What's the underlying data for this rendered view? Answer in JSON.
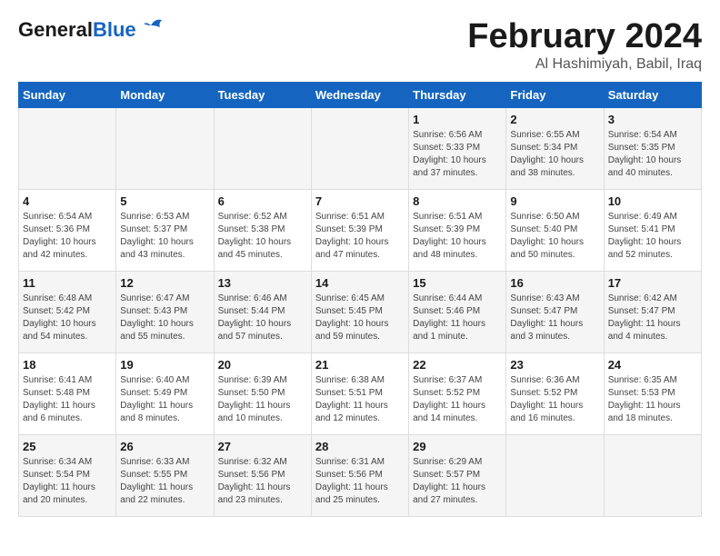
{
  "header": {
    "logo_general": "General",
    "logo_blue": "Blue",
    "title": "February 2024",
    "subtitle": "Al Hashimiyah, Babil, Iraq"
  },
  "weekdays": [
    "Sunday",
    "Monday",
    "Tuesday",
    "Wednesday",
    "Thursday",
    "Friday",
    "Saturday"
  ],
  "weeks": [
    [
      {
        "day": "",
        "sunrise": "",
        "sunset": "",
        "daylight": ""
      },
      {
        "day": "",
        "sunrise": "",
        "sunset": "",
        "daylight": ""
      },
      {
        "day": "",
        "sunrise": "",
        "sunset": "",
        "daylight": ""
      },
      {
        "day": "",
        "sunrise": "",
        "sunset": "",
        "daylight": ""
      },
      {
        "day": "1",
        "sunrise": "Sunrise: 6:56 AM",
        "sunset": "Sunset: 5:33 PM",
        "daylight": "Daylight: 10 hours and 37 minutes."
      },
      {
        "day": "2",
        "sunrise": "Sunrise: 6:55 AM",
        "sunset": "Sunset: 5:34 PM",
        "daylight": "Daylight: 10 hours and 38 minutes."
      },
      {
        "day": "3",
        "sunrise": "Sunrise: 6:54 AM",
        "sunset": "Sunset: 5:35 PM",
        "daylight": "Daylight: 10 hours and 40 minutes."
      }
    ],
    [
      {
        "day": "4",
        "sunrise": "Sunrise: 6:54 AM",
        "sunset": "Sunset: 5:36 PM",
        "daylight": "Daylight: 10 hours and 42 minutes."
      },
      {
        "day": "5",
        "sunrise": "Sunrise: 6:53 AM",
        "sunset": "Sunset: 5:37 PM",
        "daylight": "Daylight: 10 hours and 43 minutes."
      },
      {
        "day": "6",
        "sunrise": "Sunrise: 6:52 AM",
        "sunset": "Sunset: 5:38 PM",
        "daylight": "Daylight: 10 hours and 45 minutes."
      },
      {
        "day": "7",
        "sunrise": "Sunrise: 6:51 AM",
        "sunset": "Sunset: 5:39 PM",
        "daylight": "Daylight: 10 hours and 47 minutes."
      },
      {
        "day": "8",
        "sunrise": "Sunrise: 6:51 AM",
        "sunset": "Sunset: 5:39 PM",
        "daylight": "Daylight: 10 hours and 48 minutes."
      },
      {
        "day": "9",
        "sunrise": "Sunrise: 6:50 AM",
        "sunset": "Sunset: 5:40 PM",
        "daylight": "Daylight: 10 hours and 50 minutes."
      },
      {
        "day": "10",
        "sunrise": "Sunrise: 6:49 AM",
        "sunset": "Sunset: 5:41 PM",
        "daylight": "Daylight: 10 hours and 52 minutes."
      }
    ],
    [
      {
        "day": "11",
        "sunrise": "Sunrise: 6:48 AM",
        "sunset": "Sunset: 5:42 PM",
        "daylight": "Daylight: 10 hours and 54 minutes."
      },
      {
        "day": "12",
        "sunrise": "Sunrise: 6:47 AM",
        "sunset": "Sunset: 5:43 PM",
        "daylight": "Daylight: 10 hours and 55 minutes."
      },
      {
        "day": "13",
        "sunrise": "Sunrise: 6:46 AM",
        "sunset": "Sunset: 5:44 PM",
        "daylight": "Daylight: 10 hours and 57 minutes."
      },
      {
        "day": "14",
        "sunrise": "Sunrise: 6:45 AM",
        "sunset": "Sunset: 5:45 PM",
        "daylight": "Daylight: 10 hours and 59 minutes."
      },
      {
        "day": "15",
        "sunrise": "Sunrise: 6:44 AM",
        "sunset": "Sunset: 5:46 PM",
        "daylight": "Daylight: 11 hours and 1 minute."
      },
      {
        "day": "16",
        "sunrise": "Sunrise: 6:43 AM",
        "sunset": "Sunset: 5:47 PM",
        "daylight": "Daylight: 11 hours and 3 minutes."
      },
      {
        "day": "17",
        "sunrise": "Sunrise: 6:42 AM",
        "sunset": "Sunset: 5:47 PM",
        "daylight": "Daylight: 11 hours and 4 minutes."
      }
    ],
    [
      {
        "day": "18",
        "sunrise": "Sunrise: 6:41 AM",
        "sunset": "Sunset: 5:48 PM",
        "daylight": "Daylight: 11 hours and 6 minutes."
      },
      {
        "day": "19",
        "sunrise": "Sunrise: 6:40 AM",
        "sunset": "Sunset: 5:49 PM",
        "daylight": "Daylight: 11 hours and 8 minutes."
      },
      {
        "day": "20",
        "sunrise": "Sunrise: 6:39 AM",
        "sunset": "Sunset: 5:50 PM",
        "daylight": "Daylight: 11 hours and 10 minutes."
      },
      {
        "day": "21",
        "sunrise": "Sunrise: 6:38 AM",
        "sunset": "Sunset: 5:51 PM",
        "daylight": "Daylight: 11 hours and 12 minutes."
      },
      {
        "day": "22",
        "sunrise": "Sunrise: 6:37 AM",
        "sunset": "Sunset: 5:52 PM",
        "daylight": "Daylight: 11 hours and 14 minutes."
      },
      {
        "day": "23",
        "sunrise": "Sunrise: 6:36 AM",
        "sunset": "Sunset: 5:52 PM",
        "daylight": "Daylight: 11 hours and 16 minutes."
      },
      {
        "day": "24",
        "sunrise": "Sunrise: 6:35 AM",
        "sunset": "Sunset: 5:53 PM",
        "daylight": "Daylight: 11 hours and 18 minutes."
      }
    ],
    [
      {
        "day": "25",
        "sunrise": "Sunrise: 6:34 AM",
        "sunset": "Sunset: 5:54 PM",
        "daylight": "Daylight: 11 hours and 20 minutes."
      },
      {
        "day": "26",
        "sunrise": "Sunrise: 6:33 AM",
        "sunset": "Sunset: 5:55 PM",
        "daylight": "Daylight: 11 hours and 22 minutes."
      },
      {
        "day": "27",
        "sunrise": "Sunrise: 6:32 AM",
        "sunset": "Sunset: 5:56 PM",
        "daylight": "Daylight: 11 hours and 23 minutes."
      },
      {
        "day": "28",
        "sunrise": "Sunrise: 6:31 AM",
        "sunset": "Sunset: 5:56 PM",
        "daylight": "Daylight: 11 hours and 25 minutes."
      },
      {
        "day": "29",
        "sunrise": "Sunrise: 6:29 AM",
        "sunset": "Sunset: 5:57 PM",
        "daylight": "Daylight: 11 hours and 27 minutes."
      },
      {
        "day": "",
        "sunrise": "",
        "sunset": "",
        "daylight": ""
      },
      {
        "day": "",
        "sunrise": "",
        "sunset": "",
        "daylight": ""
      }
    ]
  ]
}
